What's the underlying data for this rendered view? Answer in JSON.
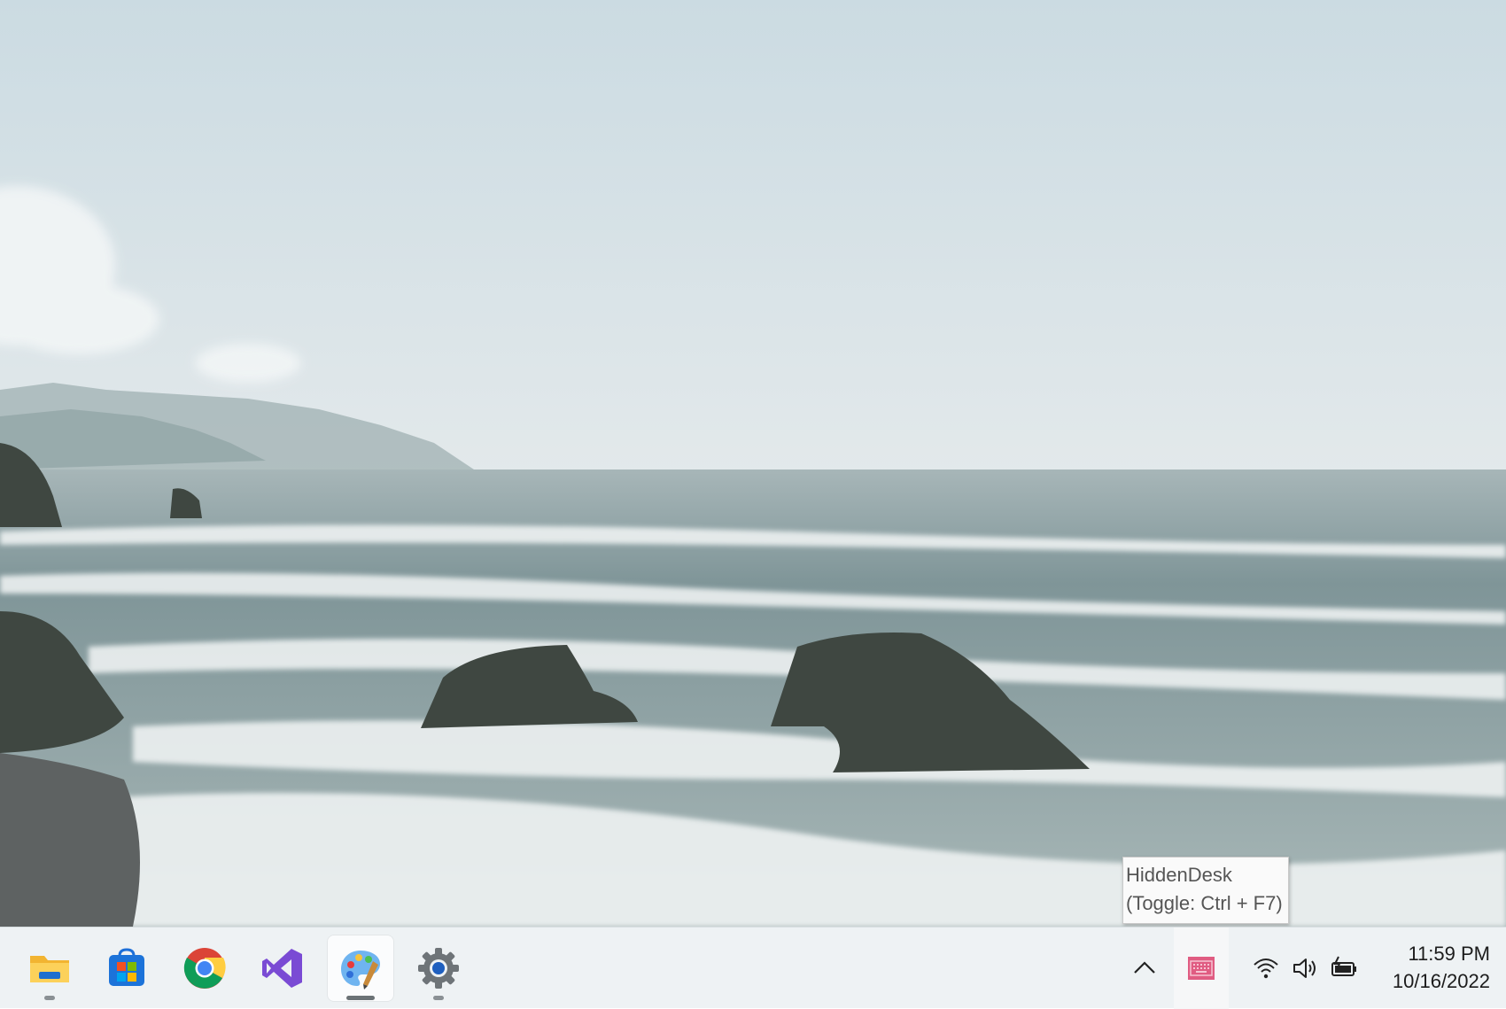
{
  "taskbar": {
    "apps": [
      {
        "label": "File Explorer",
        "icon": "file-explorer-icon",
        "running": true
      },
      {
        "label": "Microsoft Store",
        "icon": "microsoft-store-icon",
        "running": false
      },
      {
        "label": "Google Chrome",
        "icon": "chrome-icon",
        "running": false
      },
      {
        "label": "Visual Studio",
        "icon": "visual-studio-icon",
        "running": false
      },
      {
        "label": "Paint",
        "icon": "paint-icon",
        "running": true,
        "active": true
      },
      {
        "label": "Settings",
        "icon": "settings-gear-icon",
        "running": true
      }
    ]
  },
  "tray": {
    "overflow_icon": "chevron-up-icon",
    "hiddendesk_icon": "hiddendesk-keyboard-icon",
    "wifi_icon": "wifi-icon",
    "volume_icon": "volume-icon",
    "battery_icon": "battery-charging-icon"
  },
  "clock": {
    "time": "11:59 PM",
    "date": "10/16/2022"
  },
  "tooltip": {
    "line1": "HiddenDesk",
    "line2": "(Toggle: Ctrl + F7)"
  },
  "colors": {
    "taskbar_bg": "#eef2f4",
    "hiddendesk_accent": "#e05c82",
    "vs_purple": "#7a4bd4",
    "settings_blue": "#1e5fbf"
  }
}
